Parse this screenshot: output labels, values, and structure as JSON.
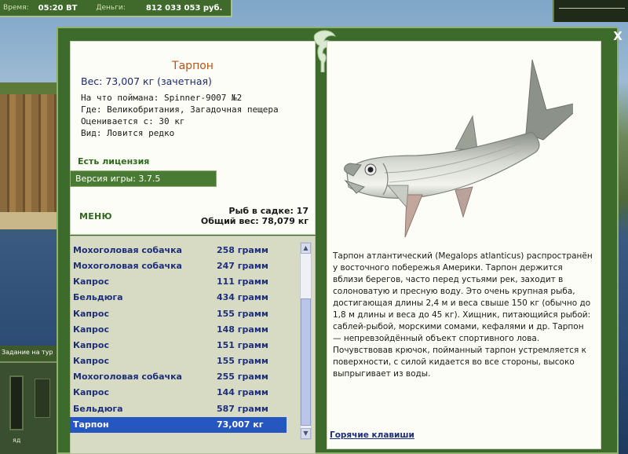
{
  "topbar": {
    "time_label": "Время:",
    "time_value": "05:20 ВТ",
    "money_label": "Деньги:",
    "money_value": "812 033 053 руб."
  },
  "left": {
    "task_label": "Задание на тур",
    "yd_label": "яд"
  },
  "info": {
    "fish_name": "Тарпон",
    "weight": "Вес: 73,007 кг (зачетная)",
    "caught_on": "На что поймана: Spinner-9007 №2",
    "where": "Где: Великобритания, Загадочная пещера",
    "valued_from": "Оценивается с: 30 кг",
    "kind": "Вид: Ловится редко",
    "license": "Есть лицензия",
    "version": "Версия игры: 3.7.5",
    "menu": "МЕНЮ",
    "catch_count": "Рыб в садке: 17",
    "catch_weight": "Общий вес: 78,079 кг"
  },
  "catch_list": [
    {
      "name": "Мохоголовая собачка",
      "weight": "258 грамм"
    },
    {
      "name": "Мохоголовая собачка",
      "weight": "247 грамм"
    },
    {
      "name": "Капрос",
      "weight": "111 грамм"
    },
    {
      "name": "Бельдюга",
      "weight": "434 грамм"
    },
    {
      "name": "Капрос",
      "weight": "155 грамм"
    },
    {
      "name": "Капрос",
      "weight": "148 грамм"
    },
    {
      "name": "Капрос",
      "weight": "151 грамм"
    },
    {
      "name": "Капрос",
      "weight": "155 грамм"
    },
    {
      "name": "Мохоголовая собачка",
      "weight": "255 грамм"
    },
    {
      "name": "Капрос",
      "weight": "144 грамм"
    },
    {
      "name": "Бельдюга",
      "weight": "587 грамм"
    },
    {
      "name": "Тарпон",
      "weight": "73,007 кг",
      "selected": true
    }
  ],
  "description": "Тарпон атлантический (Megalops atlanticus) распространён у восточного побережья Америки. Тарпон держится вблизи берегов, часто перед устьями рек, заходит в солоноватую и пресную воду. Это очень крупная рыба, достигающая длины 2,4 м и веса свыше 150 кг (обычно до 1,8 м длины и веса до 45 кг). Хищник, питающийся рыбой: саблей-рыбой, морскими сомами, кефалями и др. Тарпон — непревзойдённый объект спортивного лова. Почувствовав крючок, пойманный тарпон устремляется к поверхности, с силой кидается во все стороны, высоко выпрыгивает из воды.",
  "hotkeys": "Горячие клавиши",
  "close_symbol": "X",
  "colors": {
    "window_green": "#3d6b2c",
    "title_orange": "#b8541c",
    "list_text_blue": "#1d2f7a",
    "selection_blue": "#2657c0"
  }
}
